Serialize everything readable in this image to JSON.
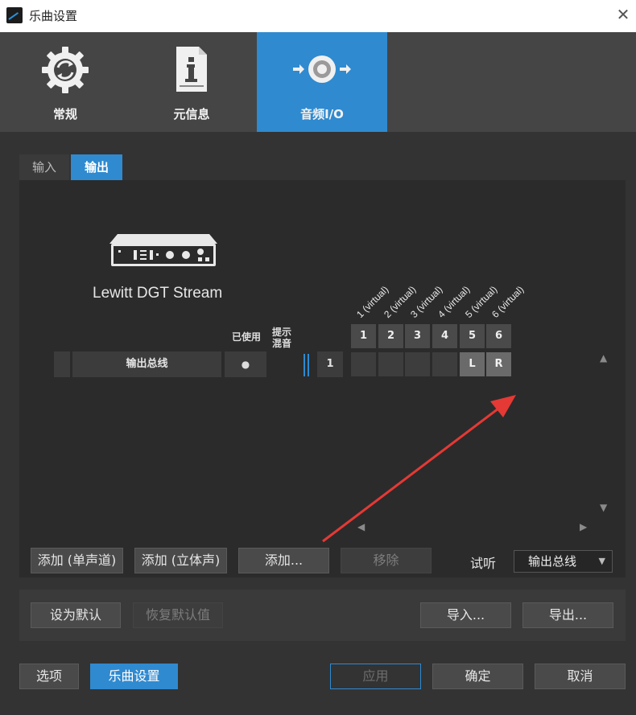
{
  "window": {
    "title": "乐曲设置",
    "close_glyph": "✕"
  },
  "top_tabs": [
    {
      "label": "常规",
      "icon": "gear-icon"
    },
    {
      "label": "元信息",
      "icon": "document-info-icon"
    },
    {
      "label": "音频I/O",
      "icon": "audio-io-icon"
    }
  ],
  "sub_tabs": {
    "input": "输入",
    "output": "输出"
  },
  "device": {
    "name": "Lewitt DGT Stream"
  },
  "columns": {
    "used": "已使用",
    "cue_mix_line1": "提示",
    "cue_mix_line2": "混音"
  },
  "virtual_channels": [
    "1 (virtual)",
    "2 (virtual)",
    "3 (virtual)",
    "4 (virtual)",
    "5 (virtual)",
    "6 (virtual)"
  ],
  "channel_numbers": [
    "1",
    "2",
    "3",
    "4",
    "5",
    "6"
  ],
  "row": {
    "name": "输出总线",
    "used_glyph": "●",
    "count": "1",
    "left": "L",
    "right": "R"
  },
  "buttons": {
    "add_mono": "添加 (单声道)",
    "add_stereo": "添加 (立体声)",
    "add": "添加...",
    "remove": "移除",
    "set_default": "设为默认",
    "restore_default": "恢复默认值",
    "import": "导入...",
    "export": "导出...",
    "options": "选项",
    "song_setup": "乐曲设置",
    "apply": "应用",
    "ok": "确定",
    "cancel": "取消"
  },
  "audition": {
    "label": "试听",
    "value": "输出总线"
  },
  "colors": {
    "accent": "#2f8ad0",
    "annotation_arrow": "#e53935"
  }
}
